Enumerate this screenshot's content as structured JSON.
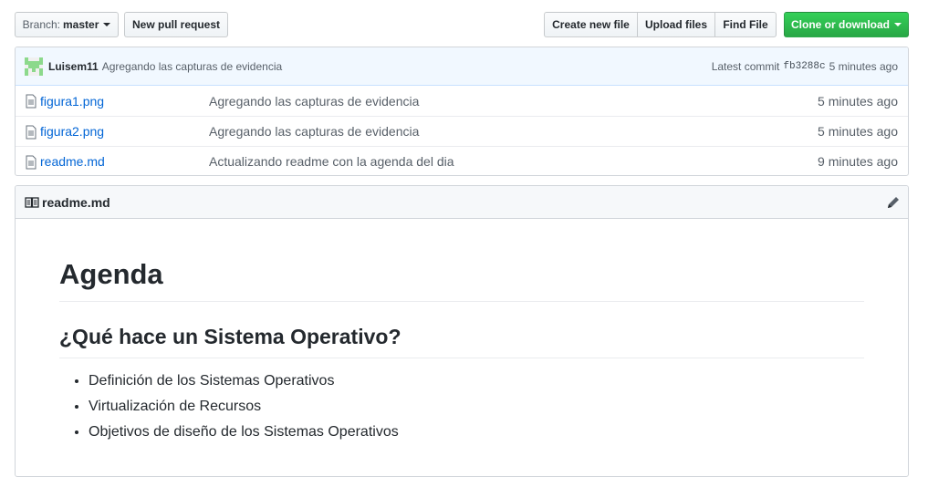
{
  "toolbar": {
    "branch_prefix": "Branch:",
    "branch_name": "master",
    "new_pull_request": "New pull request",
    "create_new_file": "Create new file",
    "upload_files": "Upload files",
    "find_file": "Find File",
    "clone_or_download": "Clone or download"
  },
  "latest_commit": {
    "author": "Luisem11",
    "message": "Agregando las capturas de evidencia",
    "label": "Latest commit",
    "sha": "fb3288c",
    "age": "5 minutes ago"
  },
  "files": [
    {
      "name": "figura1.png",
      "message": "Agregando las capturas de evidencia",
      "age": "5 minutes ago"
    },
    {
      "name": "figura2.png",
      "message": "Agregando las capturas de evidencia",
      "age": "5 minutes ago"
    },
    {
      "name": "readme.md",
      "message": "Actualizando readme con la agenda del dia",
      "age": "9 minutes ago"
    }
  ],
  "readme": {
    "filename": "readme.md",
    "h1": "Agenda",
    "h2": "¿Qué hace un Sistema Operativo?",
    "items": [
      "Definición de los Sistemas Operativos",
      "Virtualización de Recursos",
      "Objetivos de diseño de los Sistemas Operativos"
    ]
  },
  "colors": {
    "link": "#0366d6",
    "green_button": "#28a745",
    "commit_bar": "#f1f8ff",
    "avatar": "#8cd98c"
  },
  "icons": {
    "file": "file-icon",
    "book": "book-icon",
    "pencil": "pencil-icon",
    "caret": "triangle-down-icon",
    "avatar": "identicon"
  }
}
